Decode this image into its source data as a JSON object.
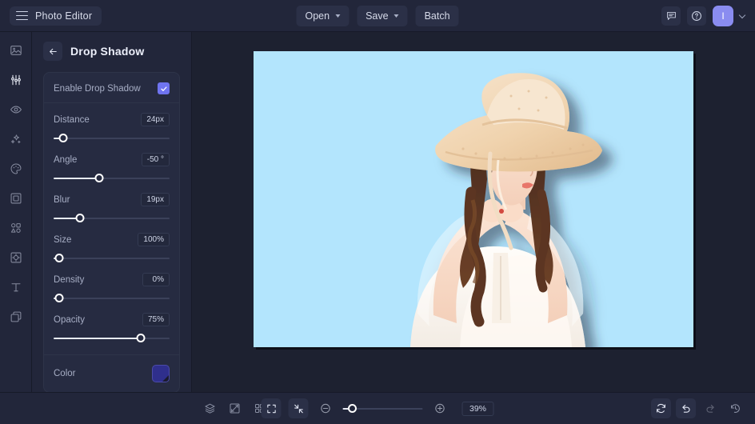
{
  "app": {
    "brand_title": "Photo Editor",
    "menu_icon": "hamburger-icon"
  },
  "topbar": {
    "open_label": "Open",
    "save_label": "Save",
    "batch_label": "Batch",
    "feedback_icon": "comment-icon",
    "help_icon": "help-circle-icon",
    "avatar_initial": "I",
    "avatar_color": "#8a8cf0"
  },
  "rail": {
    "items": [
      {
        "name": "image",
        "icon": "image-icon",
        "active": false
      },
      {
        "name": "adjust",
        "icon": "sliders-icon",
        "active": true
      },
      {
        "name": "retouch",
        "icon": "eye-icon",
        "active": false
      },
      {
        "name": "effects",
        "icon": "sparkles-icon",
        "active": false
      },
      {
        "name": "color",
        "icon": "palette-icon",
        "active": false
      },
      {
        "name": "frame",
        "icon": "frame-icon",
        "active": false
      },
      {
        "name": "shapes",
        "icon": "shapes-icon",
        "active": false
      },
      {
        "name": "crop",
        "icon": "crop-transform-icon",
        "active": false
      },
      {
        "name": "text",
        "icon": "text-icon",
        "active": false
      },
      {
        "name": "layers",
        "icon": "layers-stack-icon",
        "active": false
      }
    ]
  },
  "panel": {
    "back_icon": "arrow-left-icon",
    "title": "Drop Shadow",
    "enable": {
      "label": "Enable Drop Shadow",
      "checked": true,
      "check_icon": "check-icon"
    },
    "sliders": [
      {
        "label": "Distance",
        "value": "24px",
        "percent": 8
      },
      {
        "label": "Angle",
        "value": "-50 °",
        "percent": 39
      },
      {
        "label": "Blur",
        "value": "19px",
        "percent": 23
      },
      {
        "label": "Size",
        "value": "100%",
        "percent": 5
      },
      {
        "label": "Density",
        "value": "0%",
        "percent": 5
      },
      {
        "label": "Opacity",
        "value": "75%",
        "percent": 75
      }
    ],
    "color": {
      "label": "Color",
      "swatch_hex": "#2f2f8c"
    }
  },
  "canvas": {
    "background_hex": "#b3e5fd",
    "subject_alt": "woman in white dress wearing straw sun hat"
  },
  "bottombar": {
    "left_tools": [
      {
        "name": "layers",
        "icon": "layers-icon"
      },
      {
        "name": "compare",
        "icon": "compare-split-icon"
      },
      {
        "name": "grid",
        "icon": "grid-icon"
      }
    ],
    "fit_icon": "fit-screen-icon",
    "actual_size_icon": "collapse-arrows-icon",
    "zoom_out_icon": "minus-circle-icon",
    "zoom_in_icon": "plus-circle-icon",
    "zoom_value": "39%",
    "zoom_percent": 12,
    "right_tools": [
      {
        "name": "reset",
        "icon": "refresh-icon",
        "dim": false
      },
      {
        "name": "undo",
        "icon": "undo-arrow-icon",
        "dim": false
      },
      {
        "name": "redo",
        "icon": "redo-arrow-icon",
        "dim": true
      },
      {
        "name": "history",
        "icon": "history-clock-icon",
        "dim": false
      }
    ]
  }
}
